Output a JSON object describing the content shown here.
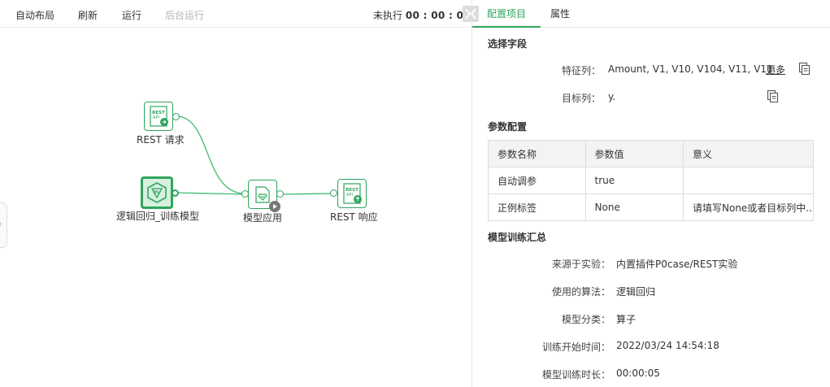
{
  "toolbar": {
    "auto_layout": "自动布局",
    "refresh": "刷新",
    "run": "运行",
    "background_run": "后台运行",
    "status_prefix": "未执行",
    "status_time": "00 : 00 : 00"
  },
  "nodes": {
    "rest_request": {
      "label": "REST 请求",
      "icon_text": "REST API"
    },
    "logreg_train": {
      "label": "逻辑回归_训练模型"
    },
    "model_apply": {
      "label": "模型应用"
    },
    "rest_response": {
      "label": "REST 响应",
      "icon_text": "REST API"
    }
  },
  "tabs": [
    {
      "label": "配置项目",
      "active": true
    },
    {
      "label": "属性",
      "active": false
    }
  ],
  "select_fields": {
    "title": "选择字段",
    "feature_label": "特征列：",
    "feature_value": "Amount, V1, V10, V104, V11, V11...",
    "more": "更多",
    "target_label": "目标列：",
    "target_value": "y."
  },
  "param_config": {
    "title": "参数配置",
    "headers": [
      "参数名称",
      "参数值",
      "意义"
    ],
    "rows": [
      [
        "自动调参",
        "true",
        ""
      ],
      [
        "正例标签",
        "None",
        "请填写None或者目标列中..."
      ]
    ]
  },
  "summary": {
    "title": "模型训练汇总",
    "items": [
      {
        "label": "来源于实验：",
        "value": "内置插件P0case/REST实验"
      },
      {
        "label": "使用的算法：",
        "value": "逻辑回归"
      },
      {
        "label": "模型分类：",
        "value": "算子"
      },
      {
        "label": "训练开始时间：",
        "value": "2022/03/24 14:54:18"
      },
      {
        "label": "模型训练时长：",
        "value": "00:00:05"
      }
    ]
  },
  "colors": {
    "accent": "#2ea55b",
    "edge": "#3dba6e"
  }
}
